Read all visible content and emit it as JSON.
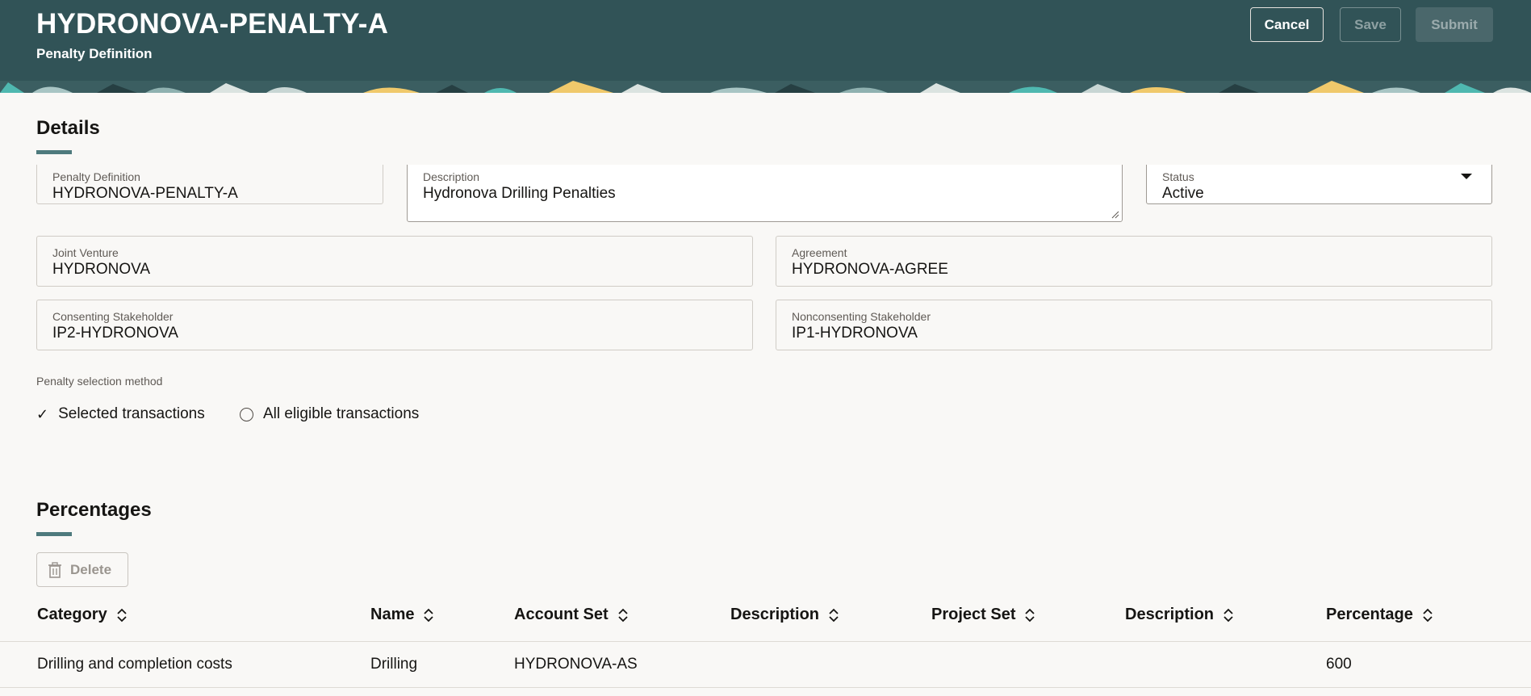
{
  "header": {
    "title": "HYDRONOVA-PENALTY-A",
    "subtitle": "Penalty Definition",
    "cancel_label": "Cancel",
    "save_label": "Save",
    "submit_label": "Submit"
  },
  "details": {
    "heading": "Details",
    "penalty_definition": {
      "label": "Penalty Definition",
      "value": "HYDRONOVA-PENALTY-A"
    },
    "description": {
      "label": "Description",
      "value": "Hydronova Drilling Penalties"
    },
    "status": {
      "label": "Status",
      "value": "Active"
    },
    "joint_venture": {
      "label": "Joint Venture",
      "value": "HYDRONOVA"
    },
    "agreement": {
      "label": "Agreement",
      "value": "HYDRONOVA-AGREE"
    },
    "consenting_stakeholder": {
      "label": "Consenting Stakeholder",
      "value": "IP2-HYDRONOVA"
    },
    "nonconsenting_stakeholder": {
      "label": "Nonconsenting Stakeholder",
      "value": "IP1-HYDRONOVA"
    },
    "selection_method": {
      "label": "Penalty selection method",
      "options": [
        "Selected transactions",
        "All eligible transactions"
      ],
      "selected": "Selected transactions"
    }
  },
  "percentages": {
    "heading": "Percentages",
    "delete_label": "Delete",
    "columns": [
      "Category",
      "Name",
      "Account Set",
      "Description",
      "Project Set",
      "Description",
      "Percentage"
    ],
    "rows": [
      [
        "Drilling and completion costs",
        "Drilling",
        "HYDRONOVA-AS",
        "",
        "",
        "",
        "600"
      ]
    ]
  },
  "colors": {
    "header_bg": "#315357",
    "accent": "#4e7a7d",
    "page_bg": "#f9f8f6"
  }
}
